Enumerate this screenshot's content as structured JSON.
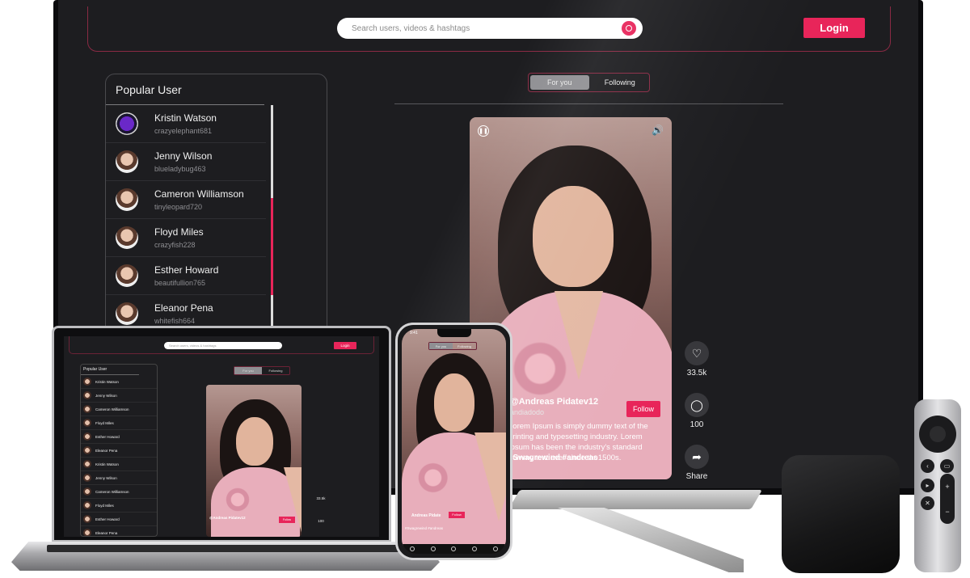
{
  "header": {
    "search_placeholder": "Search users, videos & hashtags",
    "login_label": "Login"
  },
  "sidebar": {
    "title": "Popular User",
    "users": [
      {
        "name": "Kristin Watson",
        "handle": "crazyelephant681"
      },
      {
        "name": "Jenny Wilson",
        "handle": "blueladybug463"
      },
      {
        "name": "Cameron Williamson",
        "handle": "tinyleopard720"
      },
      {
        "name": "Floyd Miles",
        "handle": "crazyfish228"
      },
      {
        "name": "Esther Howard",
        "handle": "beautifullion765"
      },
      {
        "name": "Eleanor Pena",
        "handle": "whitefish664"
      }
    ]
  },
  "tabs": {
    "for_you": "For you",
    "following": "Following"
  },
  "video": {
    "username": "@Andreas Pidatev12",
    "handle": "andiadodo",
    "follow_label": "Follow",
    "caption": "Lorem Ipsum is simply dummy text of the printing and typesetting industry. Lorem Ipsum has been the industry's standard dummy text ever since the1500s.",
    "hashtags": "#Swagrewind #andreas",
    "likes": "33.5k",
    "comments": "100",
    "share_label": "Share"
  },
  "laptop": {
    "sidebar_users": [
      "Kristin Watson",
      "Jenny Wilson",
      "Cameron Williamson",
      "Floyd Miles",
      "Esther Howard",
      "Eleanor Pena",
      "Kristin Watson",
      "Jenny Wilson",
      "Cameron Williamson",
      "Floyd Miles",
      "Esther Howard",
      "Eleanor Pena"
    ]
  },
  "phone": {
    "time": "9:41",
    "username": "Andreas Pidate",
    "follow_label": "Follow",
    "hashtags": "#Swagrewind #andreas"
  },
  "icons": {
    "pause": "pause-icon",
    "sound": "speaker-icon",
    "like": "heart-icon",
    "comment": "comment-icon",
    "share": "share-icon",
    "search": "search-icon"
  },
  "colors": {
    "accent": "#e8255a",
    "background": "#1d1d20",
    "outline": "#8a2a44"
  }
}
